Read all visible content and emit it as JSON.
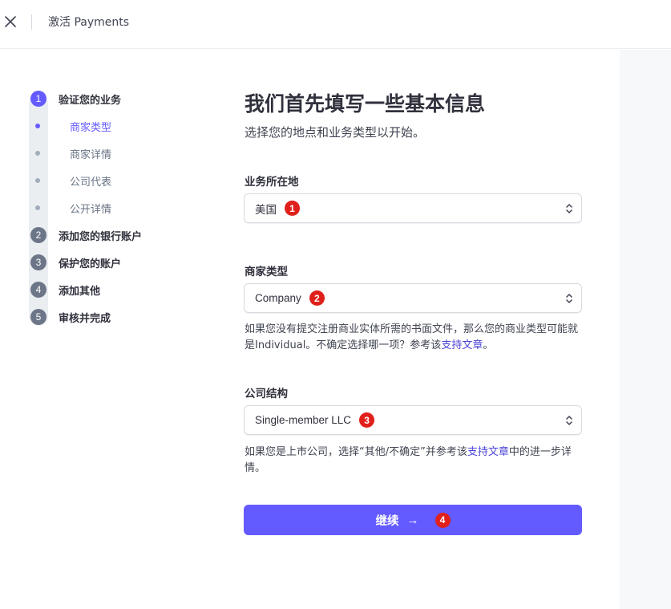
{
  "header": {
    "title": "激活 Payments",
    "close_icon": "close-icon"
  },
  "steps": [
    {
      "num": "1",
      "label": "验证您的业务",
      "active": true
    },
    {
      "num": "2",
      "label": "添加您的银行账户"
    },
    {
      "num": "3",
      "label": "保护您的账户"
    },
    {
      "num": "4",
      "label": "添加其他"
    },
    {
      "num": "5",
      "label": "审核并完成"
    }
  ],
  "substeps": [
    {
      "label": "商家类型",
      "active": true
    },
    {
      "label": "商家详情"
    },
    {
      "label": "公司代表"
    },
    {
      "label": "公开详情"
    }
  ],
  "main": {
    "title": "我们首先填写一些基本信息",
    "subtitle": "选择您的地点和业务类型以开始。",
    "location": {
      "label": "业务所在地",
      "value": "美国",
      "badge": "1"
    },
    "business_type": {
      "label": "商家类型",
      "value": "Company",
      "badge": "2",
      "help_before": "如果您没有提交注册商业实体所需的书面文件，那么您的商业类型可能就是Individual。不确定选择哪一项？参考该",
      "help_link": "支持文章",
      "help_after": "。"
    },
    "structure": {
      "label": "公司结构",
      "value": "Single-member LLC",
      "badge": "3",
      "help_before": "如果您是上市公司，选择“其他/不确定”并参考该",
      "help_link": "支持文章",
      "help_after": "中的进一步详情。"
    },
    "continue": {
      "label": "继续",
      "arrow": "→",
      "badge": "4"
    }
  },
  "colors": {
    "accent": "#635bff",
    "badge": "#e0201b",
    "step_inactive": "#6c7688"
  }
}
